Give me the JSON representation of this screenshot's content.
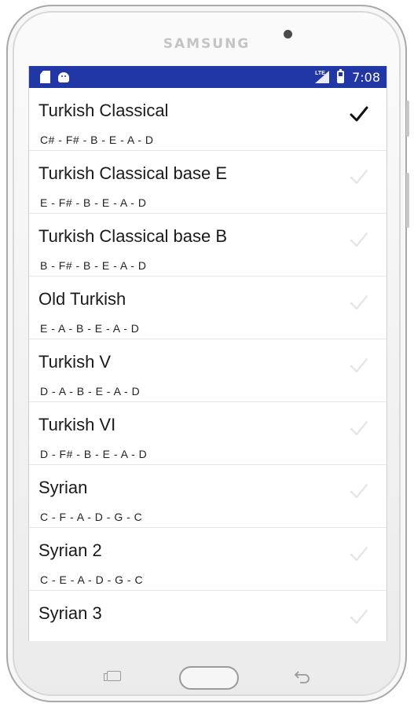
{
  "device": {
    "brand": "SAMSUNG"
  },
  "statusbar": {
    "time": "7:08",
    "network": "LTE"
  },
  "tunings": [
    {
      "name": "Turkish Classical",
      "notes": "C# - F# - B - E - A - D",
      "selected": true
    },
    {
      "name": "Turkish Classical base E",
      "notes": "E - F# - B - E - A - D",
      "selected": false
    },
    {
      "name": "Turkish Classical base B",
      "notes": "B - F# - B - E - A - D",
      "selected": false
    },
    {
      "name": "Old Turkish",
      "notes": "E - A - B - E - A - D",
      "selected": false
    },
    {
      "name": "Turkish V",
      "notes": "D - A - B - E - A - D",
      "selected": false
    },
    {
      "name": "Turkish VI",
      "notes": "D - F# - B - E - A - D",
      "selected": false
    },
    {
      "name": "Syrian",
      "notes": "C - F - A - D - G - C",
      "selected": false
    },
    {
      "name": "Syrian 2",
      "notes": "C - E - A - D - G - C",
      "selected": false
    },
    {
      "name": "Syrian 3",
      "notes": "",
      "selected": false
    }
  ],
  "colors": {
    "statusbar": "#2137a6",
    "check_selected": "#111111",
    "check_unselected": "#e6e6e6"
  },
  "icons": {
    "selected": "checkmark-icon",
    "nav_recents": "recents-icon",
    "nav_home": "home-button",
    "nav_back": "back-icon"
  }
}
